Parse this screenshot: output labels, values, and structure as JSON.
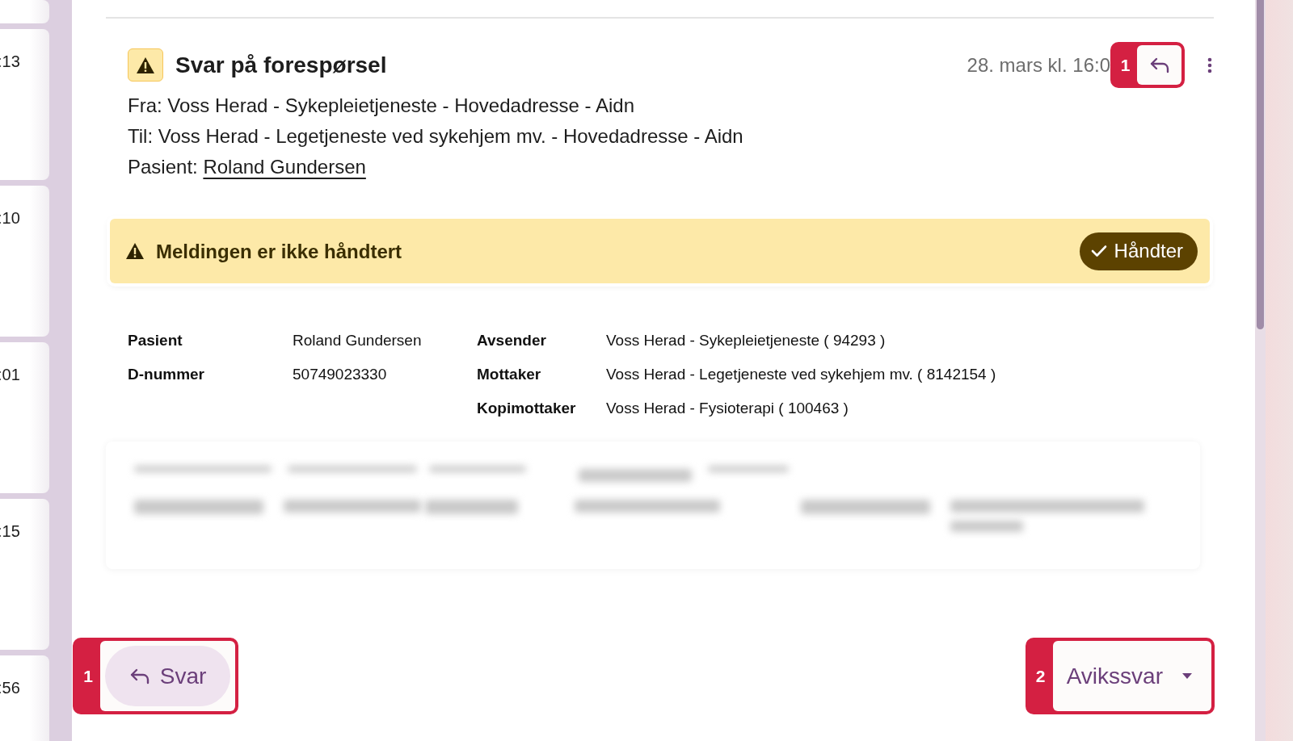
{
  "side_list": {
    "items": [
      {
        "time": ":13"
      },
      {
        "time": ":10"
      },
      {
        "time": ":01"
      },
      {
        "time": ":15"
      },
      {
        "time": ":56"
      }
    ]
  },
  "message": {
    "title": "Svar på forespørsel",
    "date": "28. mars kl. 16:0",
    "reply_annotation": "1",
    "lines": [
      {
        "text": "Fra: Voss Herad - Sykepleietjeneste - Hovedadresse - Aidn"
      },
      {
        "text": "Til: Voss Herad - Legetjeneste ved sykehjem mv. - Hovedadresse - Aidn"
      }
    ],
    "patient_label": "Pasient:",
    "patient_link": "Roland Gundersen"
  },
  "banner": {
    "text": "Meldingen er ikke håndtert",
    "button": "Håndter"
  },
  "details": [
    {
      "label": "Pasient",
      "value": "Roland  Gundersen",
      "label2": "Avsender",
      "value2": "Voss Herad  - Sykepleietjeneste ( 94293 )"
    },
    {
      "label": "D-nummer",
      "value": "50749023330",
      "label2": "Mottaker",
      "value2": "Voss Herad  - Legetjeneste ved sykehjem mv. ( 8142154 )"
    },
    {
      "label2": "Kopimottaker",
      "value2": "Voss Herad  - Fysioterapi ( 100463 )"
    }
  ],
  "footer": {
    "reply": {
      "annotation": "1",
      "label": "Svar"
    },
    "deviation": {
      "annotation": "2",
      "label": "Avikssvar"
    }
  }
}
